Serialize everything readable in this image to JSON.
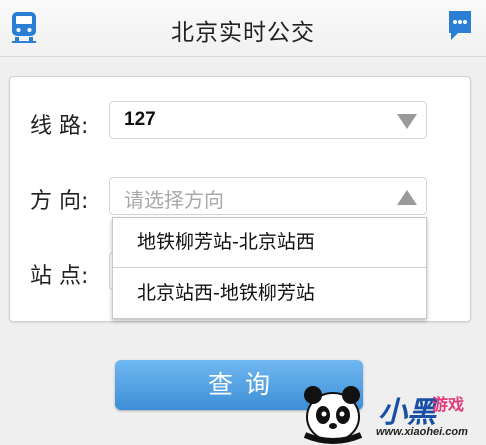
{
  "header": {
    "title": "北京实时公交",
    "left_icon": "bus-icon",
    "right_icon": "chat-icon",
    "accent_color": "#2a7fd4"
  },
  "form": {
    "route": {
      "label": "线 路:",
      "value": "127"
    },
    "direction": {
      "label": "方 向:",
      "placeholder": "请选择方向"
    },
    "station": {
      "label": "站 点:"
    }
  },
  "dropdown": {
    "options": [
      "地铁柳芳站-北京站西",
      "北京站西-地铁柳芳站"
    ]
  },
  "query_button": {
    "label": "查询"
  },
  "watermark": {
    "brand": "小黑",
    "tag": "游戏",
    "url": "www.xiaohei.com"
  }
}
